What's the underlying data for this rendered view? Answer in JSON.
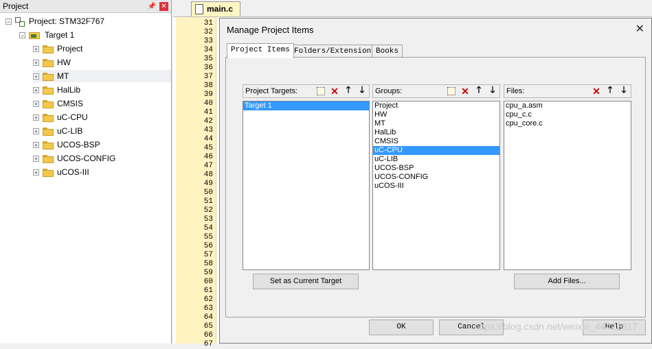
{
  "project_panel": {
    "title": "Project",
    "root_label": "Project: STM32F767",
    "target_label": "Target 1",
    "groups": [
      "Project",
      "HW",
      "MT",
      "HalLib",
      "CMSIS",
      "uC-CPU",
      "uC-LIB",
      "UCOS-BSP",
      "UCOS-CONFIG",
      "uCOS-III"
    ],
    "selected_group": "MT"
  },
  "editor": {
    "tab_label": "main.c",
    "line_numbers": [
      "31",
      "32",
      "33",
      "34",
      "35",
      "36",
      "37",
      "38",
      "39",
      "40",
      "41",
      "42",
      "43",
      "44",
      "45",
      "46",
      "47",
      "48",
      "49",
      "50",
      "51",
      "52",
      "53",
      "54",
      "55",
      "56",
      "57",
      "58",
      "59",
      "60",
      "61",
      "62",
      "63",
      "64",
      "65",
      "66",
      "67"
    ]
  },
  "dialog": {
    "title": "Manage Project Items",
    "tabs": [
      "Project Items",
      "Folders/Extensions",
      "Books"
    ],
    "project_targets": {
      "label": "Project Targets:",
      "items": [
        "Target 1"
      ],
      "selected": "Target 1"
    },
    "groups": {
      "label": "Groups:",
      "items": [
        "Project",
        "HW",
        "MT",
        "HalLib",
        "CMSIS",
        "uC-CPU",
        "uC-LIB",
        "UCOS-BSP",
        "UCOS-CONFIG",
        "uCOS-III"
      ],
      "selected": "uC-CPU"
    },
    "files": {
      "label": "Files:",
      "items": [
        "cpu_a.asm",
        "cpu_c.c",
        "cpu_core.c"
      ]
    },
    "set_current_target_button": "Set as Current Target",
    "add_files_button": "Add Files...",
    "ok_button": "OK",
    "cancel_button": "Cancel",
    "help_button": "Help"
  },
  "watermark": "https://blog.csdn.net/weixin_44422817",
  "colors": {
    "selection": "#3399ff",
    "editor_gutter": "#fff3c2",
    "tab_active": "#fff6c4"
  }
}
